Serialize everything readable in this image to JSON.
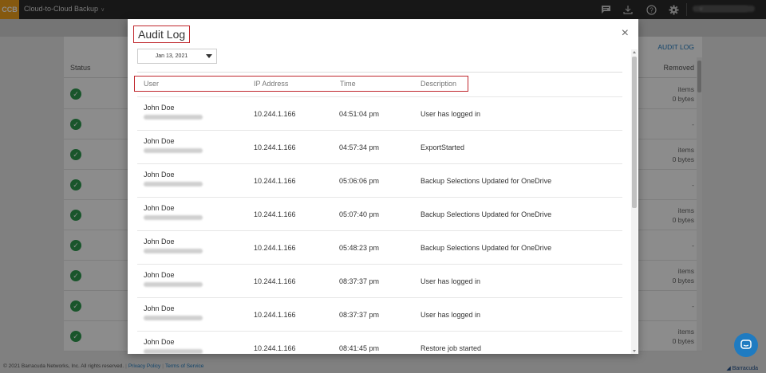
{
  "topbar": {
    "logo": "CCB",
    "app_title": "Cloud-to-Cloud Backup",
    "icons": [
      "chat-icon",
      "download-icon",
      "help-icon",
      "gear-icon"
    ]
  },
  "background": {
    "audit_log_link": "AUDIT LOG",
    "status_header": "Status",
    "removed_header": "Removed",
    "rows": [
      {
        "removed_1": "items",
        "removed_2": "0 bytes"
      },
      {
        "removed_1": "-",
        "removed_2": ""
      },
      {
        "removed_1": "items",
        "removed_2": "0 bytes"
      },
      {
        "removed_1": "-",
        "removed_2": ""
      },
      {
        "removed_1": "items",
        "removed_2": "0 bytes"
      },
      {
        "removed_1": "-",
        "removed_2": ""
      },
      {
        "removed_1": "items",
        "removed_2": "0 bytes"
      },
      {
        "removed_1": "-",
        "removed_2": ""
      },
      {
        "removed_1": "items",
        "removed_2": "0 bytes"
      }
    ]
  },
  "footer": {
    "copyright": "© 2021 Barracuda Networks, Inc. All rights reserved.",
    "privacy": "Privacy Policy",
    "terms": "Terms of Service",
    "brand": "Barracuda"
  },
  "modal": {
    "title": "Audit Log",
    "close": "×",
    "date": "Jan 13, 2021",
    "columns": {
      "user": "User",
      "ip": "IP Address",
      "time": "Time",
      "description": "Description"
    },
    "rows": [
      {
        "user": "John Doe",
        "ip": "10.244.1.166",
        "time": "04:51:04 pm",
        "description": "User has logged in"
      },
      {
        "user": "John Doe",
        "ip": "10.244.1.166",
        "time": "04:57:34 pm",
        "description": "ExportStarted"
      },
      {
        "user": "John Doe",
        "ip": "10.244.1.166",
        "time": "05:06:06 pm",
        "description": "Backup Selections Updated for OneDrive"
      },
      {
        "user": "John Doe",
        "ip": "10.244.1.166",
        "time": "05:07:40 pm",
        "description": "Backup Selections Updated for OneDrive"
      },
      {
        "user": "John Doe",
        "ip": "10.244.1.166",
        "time": "05:48:23 pm",
        "description": "Backup Selections Updated for OneDrive"
      },
      {
        "user": "John Doe",
        "ip": "10.244.1.166",
        "time": "08:37:37 pm",
        "description": "User has logged in"
      },
      {
        "user": "John Doe",
        "ip": "10.244.1.166",
        "time": "08:37:37 pm",
        "description": "User has logged in"
      },
      {
        "user": "John Doe",
        "ip": "10.244.1.166",
        "time": "08:41:45 pm",
        "description": "Restore job started"
      }
    ]
  },
  "colors": {
    "accent": "#1f7bc1",
    "highlight": "#c0272d",
    "success": "#2e9b4f",
    "logo": "#f3a21c"
  }
}
